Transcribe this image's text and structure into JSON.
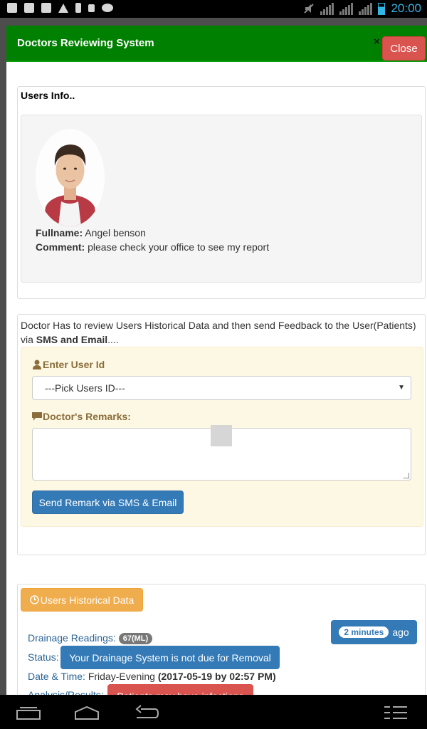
{
  "status_bar": {
    "time": "20:00",
    "left_icons": [
      "image-icon",
      "message-icon",
      "gmail-icon",
      "warning-icon",
      "usb-icon",
      "lock-icon",
      "android-icon"
    ],
    "right_icons": [
      "mute-icon",
      "h-signal-icon",
      "signal-icon",
      "signal-icon",
      "battery-icon"
    ]
  },
  "modal": {
    "title": "Doctors Reviewing System",
    "x_glyph": "×",
    "close_label": "Close"
  },
  "users_info": {
    "title": "Users Info..",
    "fullname_label": "Fullname:",
    "fullname_value": "Angel benson",
    "comment_label": "Comment:",
    "comment_value": "please check your office to see my report"
  },
  "review": {
    "intro_text": "Doctor Has to review Users Historical Data and then send Feedback to the User(Patients) via ",
    "intro_bold": "SMS and Email",
    "intro_end": "....",
    "user_id_label": "Enter User Id",
    "user_select_value": "---Pick Users ID---",
    "remarks_label": "Doctor's Remarks:",
    "remarks_value": "",
    "send_label": "Send Remark via SMS & Email"
  },
  "history": {
    "button_label": "Users Historical Data",
    "drainage_label": "Drainage Readings:",
    "drainage_value": "67(ML)",
    "status_label": "Status:",
    "status_value": "Your Drainage System is not due for Removal",
    "datetime_label": "Date & Time:",
    "datetime_day": "Friday-Evening",
    "datetime_stamp": "(2017-05-19 by 02:57 PM)",
    "analysis_label": "Analysis/Results:",
    "analysis_value": "Patients may have infections",
    "time_badge": "2 minutes",
    "time_suffix": "ago"
  },
  "colors": {
    "header_green": "#008000",
    "danger": "#d9534f",
    "primary": "#337ab7",
    "warning": "#f0ad4e",
    "status_time": "#33b5e5"
  }
}
